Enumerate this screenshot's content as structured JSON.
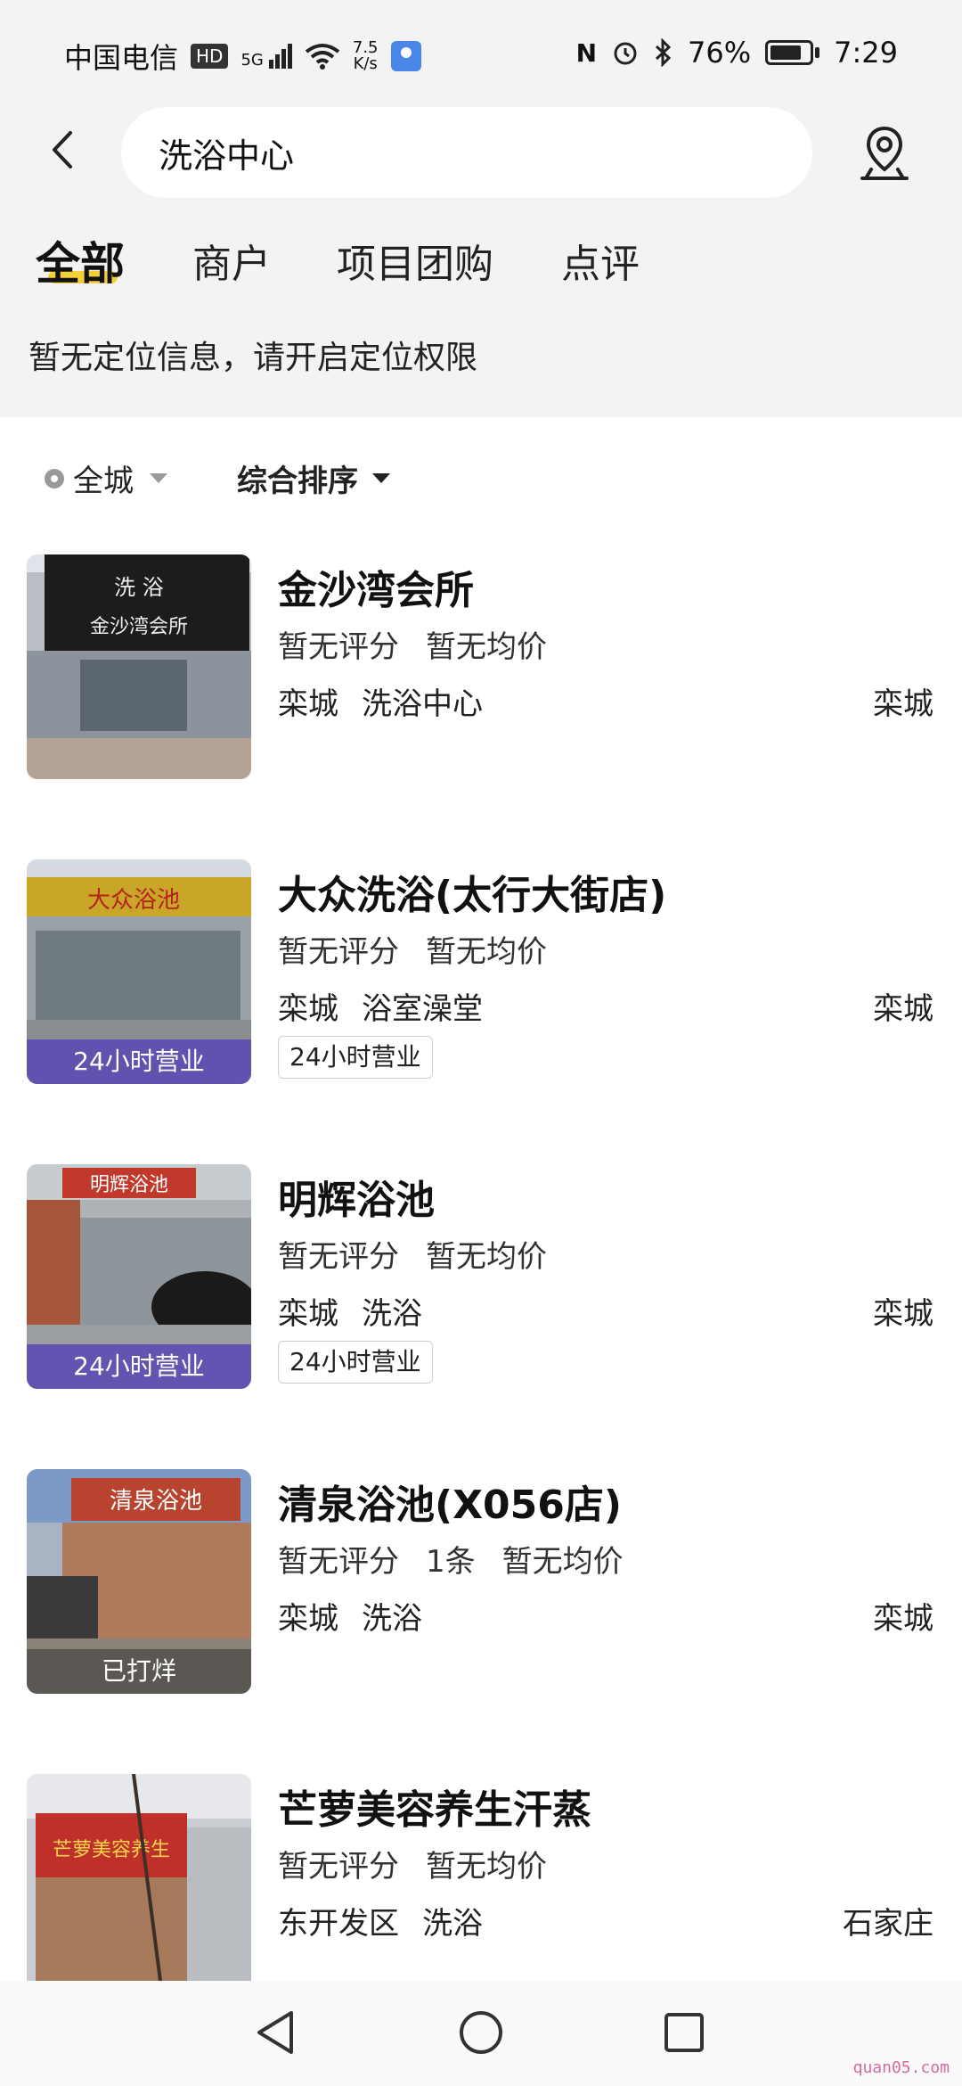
{
  "status_bar": {
    "carrier": "中国电信",
    "hd": "HD",
    "network": "5G",
    "speed_value": "7.5",
    "speed_unit": "K/s",
    "battery": "76%",
    "time": "7:29"
  },
  "header": {
    "search_value": "洗浴中心"
  },
  "tabs": [
    {
      "label": "全部",
      "active": true
    },
    {
      "label": "商户",
      "active": false
    },
    {
      "label": "项目团购",
      "active": false
    },
    {
      "label": "点评",
      "active": false
    }
  ],
  "location_message": "暂无定位信息，请开启定位权限",
  "filters": {
    "area": "全城",
    "sort": "综合排序"
  },
  "results": [
    {
      "name": "金沙湾会所",
      "rating": "暂无评分",
      "reviews": "",
      "price": "暂无均价",
      "district": "栾城",
      "category": "洗浴中心",
      "city": "栾城",
      "image_badge": "",
      "chip": "",
      "sign_text": "洗浴 金沙湾会所"
    },
    {
      "name": "大众洗浴(太行大街店)",
      "rating": "暂无评分",
      "reviews": "",
      "price": "暂无均价",
      "district": "栾城",
      "category": "浴室澡堂",
      "city": "栾城",
      "image_badge": "24小时营业",
      "chip": "24小时营业",
      "sign_text": "大众浴池"
    },
    {
      "name": "明辉浴池",
      "rating": "暂无评分",
      "reviews": "",
      "price": "暂无均价",
      "district": "栾城",
      "category": "洗浴",
      "city": "栾城",
      "image_badge": "24小时营业",
      "chip": "24小时营业",
      "sign_text": "明辉浴池"
    },
    {
      "name": "清泉浴池(X056店)",
      "rating": "暂无评分",
      "reviews": "1条",
      "price": "暂无均价",
      "district": "栾城",
      "category": "洗浴",
      "city": "栾城",
      "image_badge": "已打烊",
      "chip": "",
      "sign_text": "清泉浴池"
    },
    {
      "name": "芒萝美容养生汗蒸",
      "rating": "暂无评分",
      "reviews": "",
      "price": "暂无均价",
      "district": "东开发区",
      "category": "洗浴",
      "city": "石家庄",
      "image_badge": "",
      "chip": "",
      "sign_text": "芒萝美容养生汗蒸"
    }
  ],
  "watermark": "quan05.com",
  "colors": {
    "accent_yellow": "#f4d038",
    "badge_purple": "#5c4ab4",
    "page_gray": "#f3f3f3"
  }
}
